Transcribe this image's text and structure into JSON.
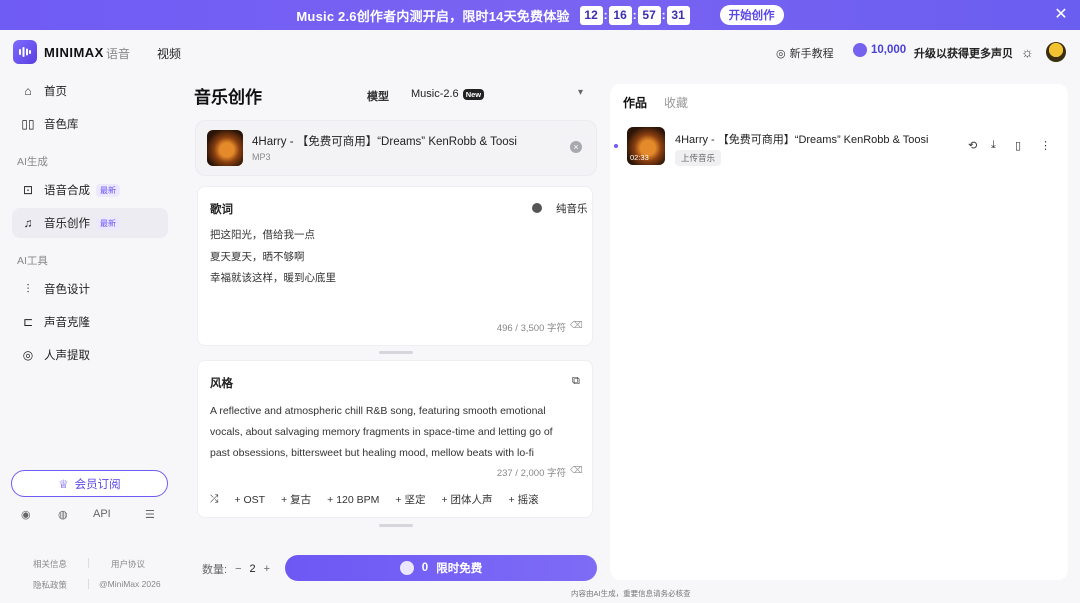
{
  "banner": {
    "text": "Music 2.6创作者内测开启，限时14天免费体验",
    "countdown": [
      "12",
      "16",
      "57",
      "31"
    ],
    "button": "开始创作",
    "close_icon": "close-icon"
  },
  "header": {
    "logo": "MINIMAX",
    "nav": [
      "语音",
      "视频"
    ],
    "tutorial": "新手教程",
    "credits": "10,000",
    "upgrade": "升级以获得更多声贝"
  },
  "sidebar": {
    "items": [
      {
        "label": "首页",
        "icon": "home-icon"
      },
      {
        "label": "音色库",
        "icon": "library-icon"
      }
    ],
    "section_ai_gen": "AI生成",
    "gen_items": [
      {
        "label": "语音合成",
        "badge": "最新",
        "icon": "speech-icon"
      },
      {
        "label": "音乐创作",
        "badge": "最新",
        "icon": "music-note-icon"
      }
    ],
    "section_ai_tools": "AI工具",
    "tool_items": [
      {
        "label": "音色设计",
        "icon": "voice-design-icon"
      },
      {
        "label": "声音克隆",
        "icon": "voice-clone-icon"
      },
      {
        "label": "人声提取",
        "icon": "vocal-extract-icon"
      }
    ],
    "member_button": "会员订阅",
    "social": {
      "api": "API"
    },
    "footer": {
      "about": "相关信息",
      "terms": "用户协议",
      "privacy": "隐私政策",
      "copyright": "@MiniMax 2026"
    }
  },
  "main": {
    "title": "音乐创作",
    "model_label": "模型",
    "model_value": "Music-2.6",
    "model_badge": "New",
    "track": {
      "title": "4Harry - 【免费可商用】“Dreams” KenRobb & Toosi",
      "format": "MP3"
    },
    "lyrics": {
      "title": "歌词",
      "toggle_label": "纯音乐",
      "lines": [
        "把这阳光，借给我一点",
        "夏天夏天，晒不够啊",
        "幸福就该这样，暖到心底里"
      ],
      "counter": "496 / 3,500 字符"
    },
    "style": {
      "title": "风格",
      "text": "A reflective and atmospheric chill R&B song, featuring smooth emotional vocals, about salvaging memory fragments in space-time and letting go of past obsessions, bittersweet but healing mood, mellow beats with lo-fi",
      "counter": "237 / 2,000 字符",
      "tags": [
        "OST",
        "复古",
        "120 BPM",
        "坚定",
        "团体人声",
        "摇滚"
      ]
    },
    "quantity_label": "数量:",
    "quantity_value": "2",
    "generate": {
      "cost": "0",
      "label": "限时免费"
    }
  },
  "right": {
    "tabs": [
      "作品",
      "收藏"
    ],
    "works": [
      {
        "title": "4Harry - 【免费可商用】“Dreams” KenRobb & Toosi",
        "tag": "上传音乐",
        "duration": "02:33"
      }
    ]
  },
  "disclaimer": "内容由AI生成，重要信息请务必核查"
}
